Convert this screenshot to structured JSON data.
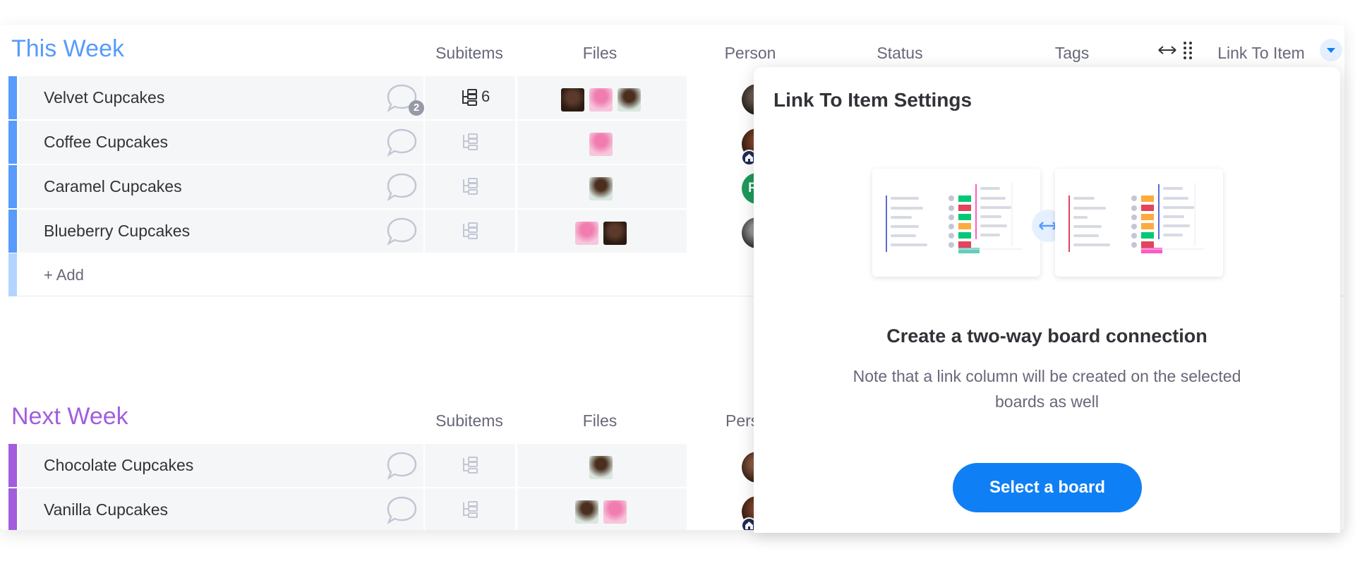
{
  "groups": [
    {
      "title": "This Week",
      "color": "#579bfc",
      "columns": {
        "subitems": "Subitems",
        "files": "Files",
        "person": "Person",
        "status": "Status",
        "tags": "Tags",
        "link_to_item": "Link To Item"
      },
      "rows": [
        {
          "name": "Velvet Cupcakes",
          "updates_count": "2",
          "subitems_count": "6",
          "files": [
            "chocolate",
            "pink",
            "chocolate-mint"
          ],
          "person": "photo-woman-dark"
        },
        {
          "name": "Coffee Cupcakes",
          "updates_count": "",
          "subitems_count": "",
          "files": [
            "pink"
          ],
          "person": "photo-woman-curly"
        },
        {
          "name": "Caramel Cupcakes",
          "updates_count": "",
          "subitems_count": "",
          "files": [
            "chocolate-mint"
          ],
          "person": "initials",
          "person_initials": "RI"
        },
        {
          "name": "Blueberry Cupcakes",
          "updates_count": "",
          "subitems_count": "",
          "files": [
            "pink",
            "chocolate"
          ],
          "person": "photo-man"
        }
      ],
      "add_label": "+ Add"
    },
    {
      "title": "Next Week",
      "color": "#a25ddc",
      "columns": {
        "subitems": "Subitems",
        "files": "Files",
        "person": "Pers"
      },
      "rows": [
        {
          "name": "Chocolate Cupcakes",
          "files": [
            "chocolate-mint"
          ],
          "person": "photo-woman-dark"
        },
        {
          "name": "Vanilla Cupcakes",
          "files": [
            "chocolate-mint",
            "pink"
          ],
          "person": "photo-woman-curly"
        }
      ]
    }
  ],
  "header_icons": {
    "resize": "resize-horizontal-icon",
    "drag": "drag-handle-icon",
    "dropdown": "chevron-down-icon"
  },
  "panel": {
    "title": "Link To Item Settings",
    "heading": "Create a two-way board connection",
    "note": "Note that a link column will be created on the selected boards as well",
    "button_label": "Select a board"
  },
  "colors": {
    "accent": "#0f7ff5",
    "group1": "#579bfc",
    "group2": "#a25ddc",
    "status_green": "#00c875",
    "status_orange": "#fdab3d",
    "status_red": "#e2445c",
    "tag_pink": "#ff5ac4",
    "tag_teal": "#66ccbb"
  }
}
